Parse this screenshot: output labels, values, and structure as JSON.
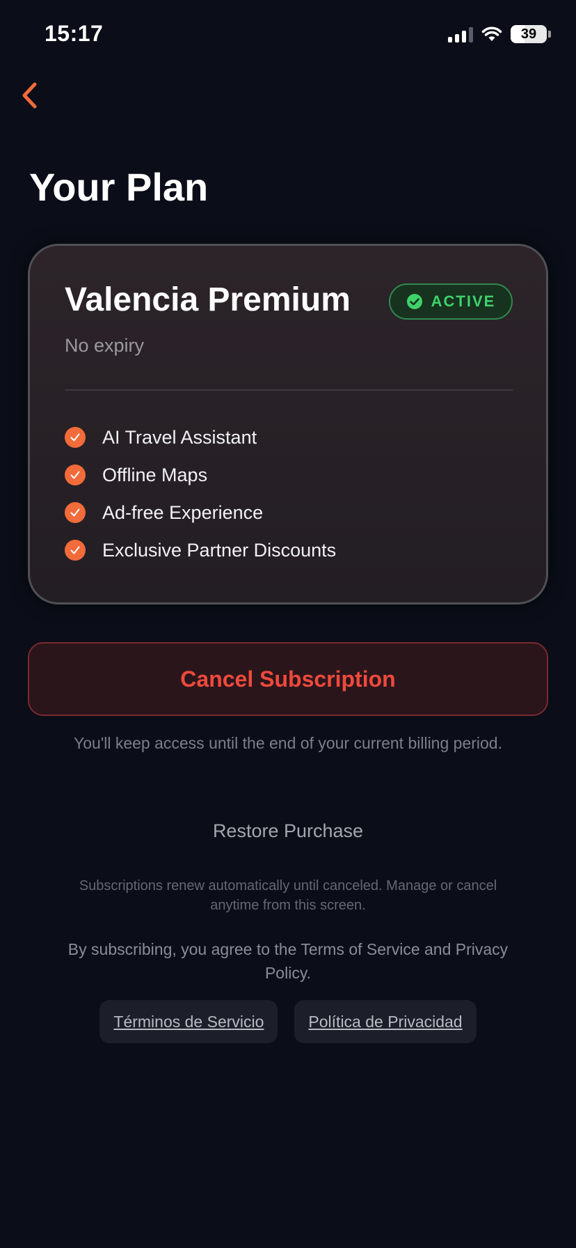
{
  "status_bar": {
    "time": "15:17",
    "battery": "39",
    "battery_level": 0.39
  },
  "nav": {
    "back_icon": "chevron-left-icon",
    "accent": "#f26b3a"
  },
  "page": {
    "title": "Your Plan"
  },
  "plan": {
    "name": "Valencia Premium",
    "badge": "ACTIVE",
    "subtitle": "No expiry",
    "features": [
      "AI Travel Assistant",
      "Offline Maps",
      "Ad-free Experience",
      "Exclusive Partner Discounts"
    ]
  },
  "actions": {
    "cancel_label": "Cancel Subscription",
    "cancel_note": "You'll keep access until the end of your current billing period.",
    "restore_label": "Restore Purchase"
  },
  "legal": {
    "renew_note": "Subscriptions renew automatically until canceled. Manage or cancel anytime from this screen.",
    "agree_note": "By subscribing, you agree to the Terms of Service and Privacy Policy.",
    "terms_label": "Términos de Servicio",
    "privacy_label": "Política de Privacidad"
  },
  "colors": {
    "background": "#0b0e18",
    "active_green": "#3fd26b",
    "cancel_red": "#ee4a3c"
  }
}
